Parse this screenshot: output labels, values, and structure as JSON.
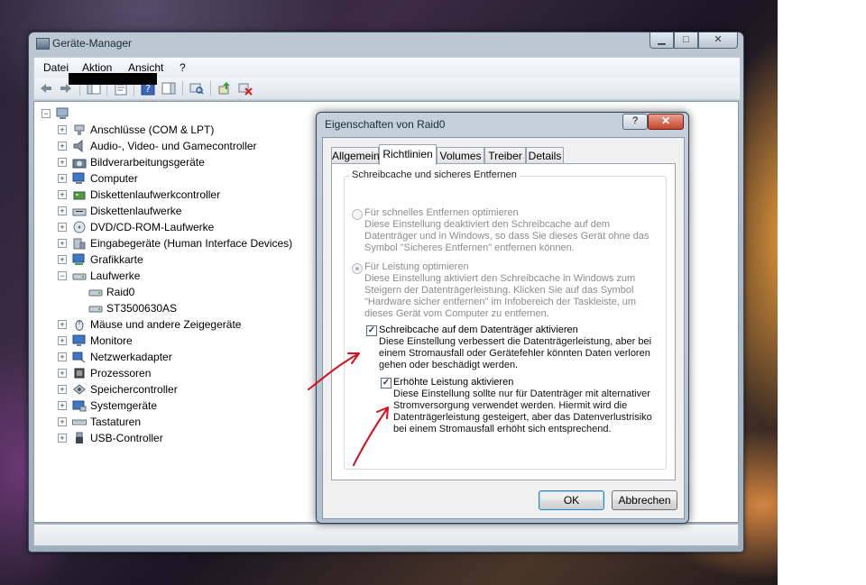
{
  "main_window": {
    "title": "Geräte-Manager",
    "caption_buttons": {
      "minimize": "▁",
      "maximize": "□",
      "close": "✕"
    }
  },
  "menu": {
    "items": [
      "Datei",
      "Aktion",
      "Ansicht",
      "?"
    ]
  },
  "toolbar": {
    "icons": [
      "back-arrow-icon",
      "forward-arrow-icon",
      "show-hide-console-tree-icon",
      "properties-icon",
      "help-icon",
      "show-hide-action-pane-icon",
      "scan-hardware-icon",
      "update-driver-icon",
      "uninstall-device-icon"
    ]
  },
  "device_tree": {
    "root_label": "",
    "categories": [
      {
        "label": "Anschlüsse (COM & LPT)",
        "icon": "port-icon",
        "expanded": false
      },
      {
        "label": "Audio-, Video- und Gamecontroller",
        "icon": "speaker-icon",
        "expanded": false
      },
      {
        "label": "Bildverarbeitungsgeräte",
        "icon": "camera-icon",
        "expanded": false
      },
      {
        "label": "Computer",
        "icon": "computer-icon",
        "expanded": false
      },
      {
        "label": "Diskettenlaufwerkcontroller",
        "icon": "floppy-controller-icon",
        "expanded": false
      },
      {
        "label": "Diskettenlaufwerke",
        "icon": "floppy-drive-icon",
        "expanded": false
      },
      {
        "label": "DVD/CD-ROM-Laufwerke",
        "icon": "dvd-drive-icon",
        "expanded": false
      },
      {
        "label": "Eingabegeräte (Human Interface Devices)",
        "icon": "hid-icon",
        "expanded": false
      },
      {
        "label": "Grafikkarte",
        "icon": "display-adapter-icon",
        "expanded": false
      },
      {
        "label": "Laufwerke",
        "icon": "disk-drive-icon",
        "expanded": true,
        "children": [
          {
            "label": "Raid0",
            "icon": "disk-drive-icon"
          },
          {
            "label": "ST3500630AS",
            "icon": "disk-drive-icon"
          }
        ]
      },
      {
        "label": "Mäuse und andere Zeigegeräte",
        "icon": "mouse-icon",
        "expanded": false
      },
      {
        "label": "Monitore",
        "icon": "monitor-icon",
        "expanded": false
      },
      {
        "label": "Netzwerkadapter",
        "icon": "network-adapter-icon",
        "expanded": false
      },
      {
        "label": "Prozessoren",
        "icon": "processor-icon",
        "expanded": false
      },
      {
        "label": "Speichercontroller",
        "icon": "storage-controller-icon",
        "expanded": false
      },
      {
        "label": "Systemgeräte",
        "icon": "system-devices-icon",
        "expanded": false
      },
      {
        "label": "Tastaturen",
        "icon": "keyboard-icon",
        "expanded": false
      },
      {
        "label": "USB-Controller",
        "icon": "usb-icon",
        "expanded": false
      }
    ]
  },
  "dialog": {
    "title": "Eigenschaften von Raid0",
    "help_button": "?",
    "close_button": "✕",
    "tabs": [
      "Allgemein",
      "Richtlinien",
      "Volumes",
      "Treiber",
      "Details"
    ],
    "active_tab": "Richtlinien",
    "group_title": "Schreibcache und sicheres Entfernen",
    "options": {
      "quick_removal": {
        "label": "Für schnelles Entfernen optimieren",
        "description": [
          "Diese Einstellung deaktiviert den Schreibcache auf dem",
          "Datenträger und in Windows, so dass Sie dieses Gerät ohne das",
          "Symbol \"Sicheres Entfernen\" entfernen können."
        ],
        "checked": false,
        "enabled": false
      },
      "performance": {
        "label": "Für Leistung optimieren",
        "description": [
          "Diese Einstellung aktiviert den Schreibcache in Windows zum",
          "Steigern der Datenträgerleistung. Klicken Sie auf das Symbol",
          "\"Hardware sicher entfernen\" im Infobereich der Taskleiste, um",
          "dieses Gerät vom Computer zu entfernen."
        ],
        "checked": true,
        "enabled": false
      },
      "write_cache": {
        "label": "Schreibcache auf dem Datenträger aktivieren",
        "description": [
          "Diese Einstellung verbessert die Datenträgerleistung, aber bei",
          "einem Stromausfall oder Gerätefehler könnten Daten verloren",
          "gehen oder beschädigt werden."
        ],
        "checked": true
      },
      "advanced_performance": {
        "label": "Erhöhte Leistung aktivieren",
        "description": [
          "Diese Einstellung sollte nur für Datenträger mit alternativer",
          "Stromversorgung verwendet werden. Hiermit wird die",
          "Datenträgerleistung gesteigert, aber das Datenverlustrisiko",
          "bei einem Stromausfall erhöht sich entsprechend."
        ],
        "checked": true
      }
    },
    "ok_button": "OK",
    "cancel_button": "Abbrechen"
  },
  "colors": {
    "annotation_red": "#d40f1e",
    "window_frame": "#a9b8c5",
    "focus_blue": "#3c7fb1"
  }
}
